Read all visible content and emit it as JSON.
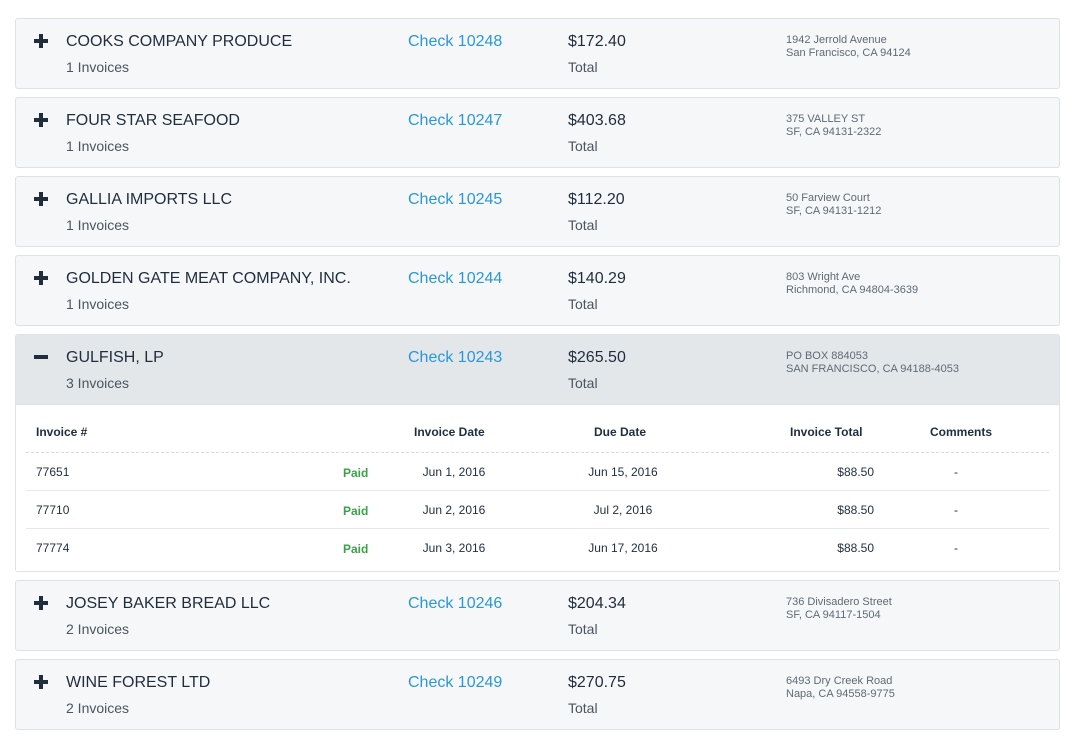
{
  "vendors": [
    {
      "name": "COOKS COMPANY PRODUCE",
      "invoices": "1 Invoices",
      "check": "Check 10248",
      "amount": "$172.40",
      "amount_label": "Total",
      "address_line1": "1942 Jerrold Avenue",
      "address_line2": "San Francisco, CA 94124",
      "expanded": false
    },
    {
      "name": "FOUR STAR SEAFOOD",
      "invoices": "1 Invoices",
      "check": "Check 10247",
      "amount": "$403.68",
      "amount_label": "Total",
      "address_line1": "375 VALLEY ST",
      "address_line2": "SF, CA 94131-2322",
      "expanded": false
    },
    {
      "name": "GALLIA IMPORTS LLC",
      "invoices": "1 Invoices",
      "check": "Check 10245",
      "amount": "$112.20",
      "amount_label": "Total",
      "address_line1": "50 Farview Court",
      "address_line2": "SF, CA 94131-1212",
      "expanded": false
    },
    {
      "name": "GOLDEN GATE MEAT COMPANY, INC.",
      "invoices": "1 Invoices",
      "check": "Check 10244",
      "amount": "$140.29",
      "amount_label": "Total",
      "address_line1": "803 Wright Ave",
      "address_line2": "Richmond, CA 94804-3639",
      "expanded": false
    },
    {
      "name": "GULFISH, LP",
      "invoices": "3 Invoices",
      "check": "Check 10243",
      "amount": "$265.50",
      "amount_label": "Total",
      "address_line1": "PO BOX 884053",
      "address_line2": "SAN FRANCISCO, CA 94188-4053",
      "expanded": true
    },
    {
      "name": "JOSEY BAKER BREAD LLC",
      "invoices": "2 Invoices",
      "check": "Check 10246",
      "amount": "$204.34",
      "amount_label": "Total",
      "address_line1": "736 Divisadero Street",
      "address_line2": "SF, CA 94117-1504",
      "expanded": false
    },
    {
      "name": "WINE FOREST LTD",
      "invoices": "2 Invoices",
      "check": "Check 10249",
      "amount": "$270.75",
      "amount_label": "Total",
      "address_line1": "6493 Dry Creek Road",
      "address_line2": "Napa, CA 94558-9775",
      "expanded": false
    }
  ],
  "invoice_table": {
    "headers": {
      "number": "Invoice #",
      "date": "Invoice Date",
      "due": "Due Date",
      "total": "Invoice Total",
      "comments": "Comments"
    },
    "rows": [
      {
        "number": "77651",
        "status": "Paid",
        "date": "Jun 1, 2016",
        "due": "Jun 15, 2016",
        "total": "$88.50",
        "comments": "-"
      },
      {
        "number": "77710",
        "status": "Paid",
        "date": "Jun 2, 2016",
        "due": "Jul 2, 2016",
        "total": "$88.50",
        "comments": "-"
      },
      {
        "number": "77774",
        "status": "Paid",
        "date": "Jun 3, 2016",
        "due": "Jun 17, 2016",
        "total": "$88.50",
        "comments": "-"
      }
    ]
  },
  "colors": {
    "link": "#2a97d8",
    "paid": "#3aa34a",
    "text": "#1f2d3d",
    "expanded_row": "#e4e7ea"
  }
}
